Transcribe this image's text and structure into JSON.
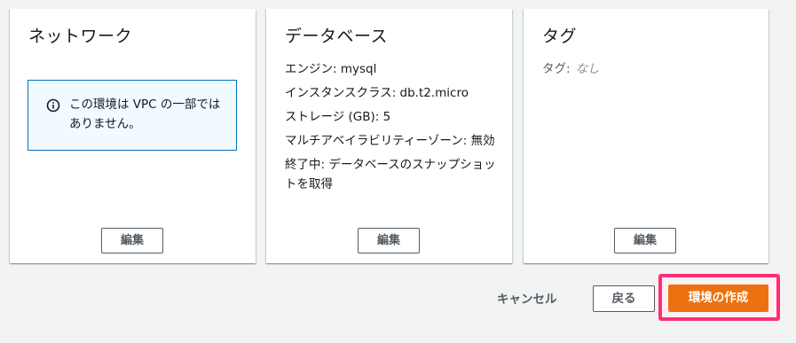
{
  "network": {
    "title": "ネットワーク",
    "info_text": "この環境は VPC の一部ではありません。",
    "edit_label": "編集"
  },
  "database": {
    "title": "データベース",
    "details": [
      "エンジン: mysql",
      "インスタンスクラス: db.t2.micro",
      "ストレージ (GB): 5",
      "マルチアベイラビリティーゾーン: 無効",
      "終了中: データベースのスナップショットを取得"
    ],
    "edit_label": "編集"
  },
  "tags": {
    "title": "タグ",
    "tag_label": "タグ:",
    "tag_value": "なし",
    "edit_label": "編集"
  },
  "footer": {
    "cancel_label": "キャンセル",
    "back_label": "戻る",
    "create_label": "環境の作成"
  },
  "colors": {
    "primary_button": "#ec7211",
    "highlight_border": "#ff2d78",
    "info_border": "#0073bb",
    "info_background": "#f1faff"
  },
  "icons": {
    "info": "info-circle-icon"
  }
}
